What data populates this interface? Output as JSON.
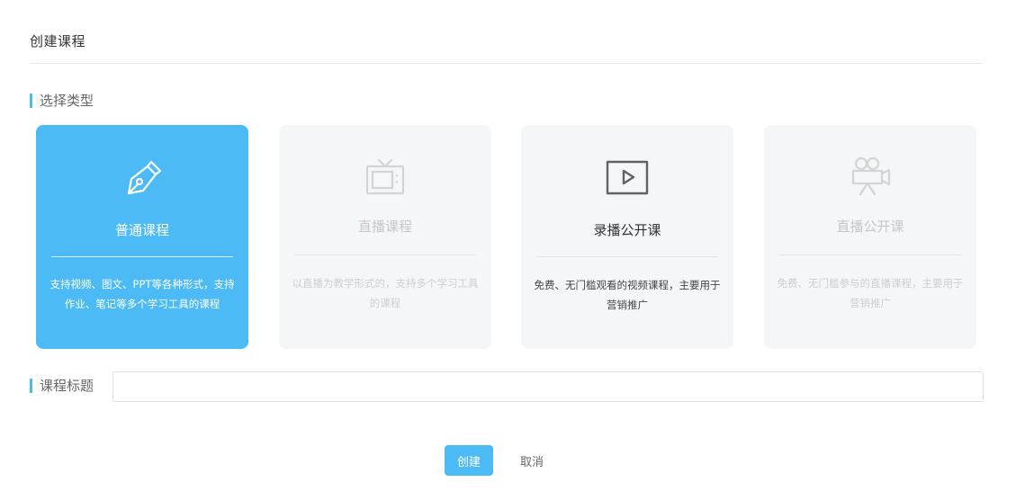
{
  "page": {
    "title": "创建课程"
  },
  "section_type": {
    "label": "选择类型"
  },
  "course_types": [
    {
      "name": "普通课程",
      "description": "支持视频、图文、PPT等各种形式，支持作业、笔记等多个学习工具的课程",
      "state": "selected",
      "icon": "pen-nib-icon"
    },
    {
      "name": "直播课程",
      "description": "以直播为教学形式的，支持多个学习工具的课程",
      "state": "disabled",
      "icon": "tv-icon"
    },
    {
      "name": "录播公开课",
      "description": "免费、无门槛观看的视频课程，主要用于营销推广",
      "state": "normal",
      "icon": "play-screen-icon"
    },
    {
      "name": "直播公开课",
      "description": "免费、无门槛参与的直播课程，主要用于营销推广",
      "state": "disabled",
      "icon": "video-camera-icon"
    }
  ],
  "section_title": {
    "label": "课程标题"
  },
  "title_input": {
    "value": "",
    "placeholder": ""
  },
  "actions": {
    "create_label": "创建",
    "cancel_label": "取消"
  },
  "colors": {
    "accent": "#4bbaf5",
    "card_background": "#f5f6f8",
    "disabled_text": "#c7c7c7"
  }
}
